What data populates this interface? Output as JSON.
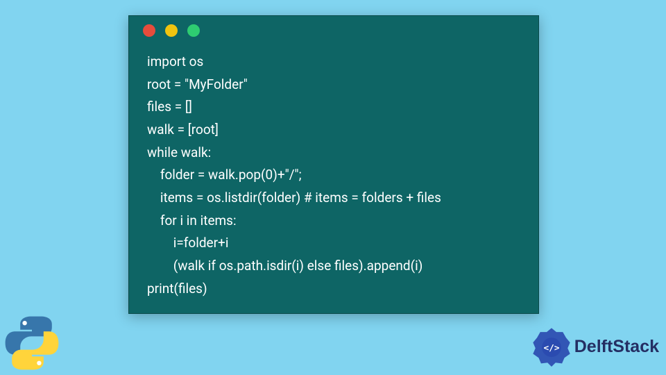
{
  "window": {
    "dots": [
      "red",
      "yellow",
      "green"
    ]
  },
  "code": {
    "lines": [
      "import os",
      "root = \"MyFolder\"",
      "files = []",
      "walk = [root]",
      "while walk:",
      "    folder = walk.pop(0)+\"/\";",
      "    items = os.listdir(folder) # items = folders + files",
      "    for i in items:",
      "        i=folder+i",
      "        (walk if os.path.isdir(i) else files).append(i)",
      "print(files)"
    ]
  },
  "branding": {
    "name": "DelftStack",
    "python_colors": {
      "top": "#3776ab",
      "bottom": "#ffd43b"
    },
    "badge_color": "#2b4bb0"
  }
}
